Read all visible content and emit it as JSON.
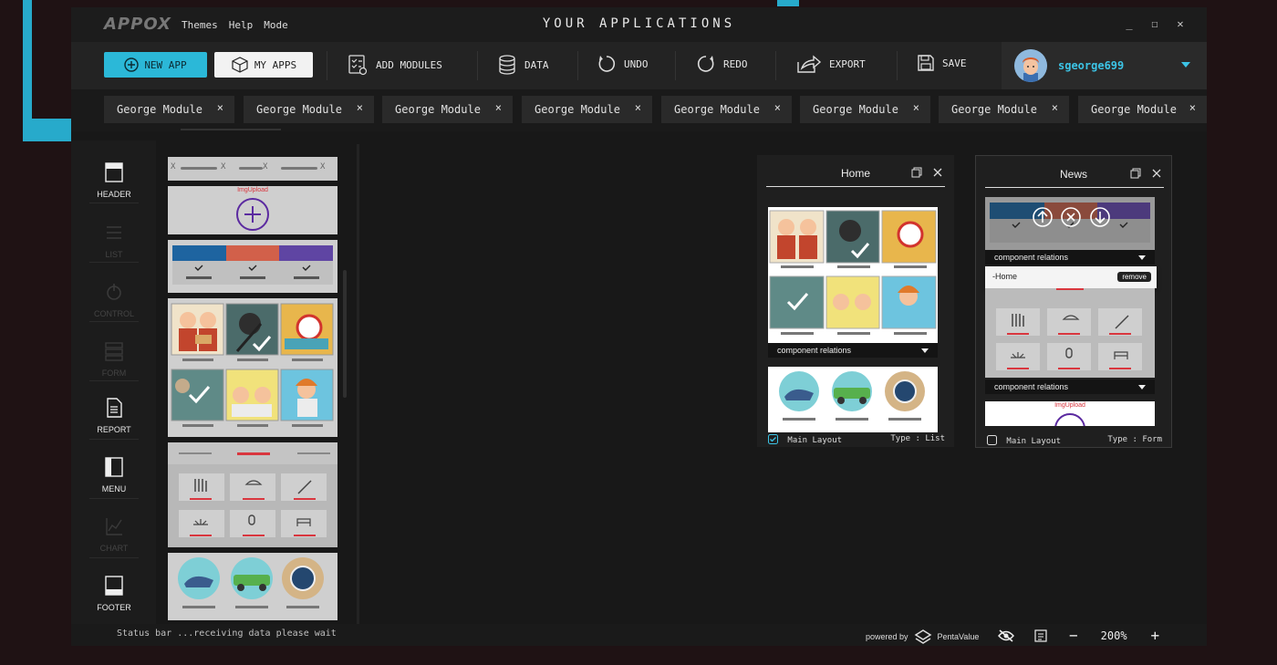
{
  "app": {
    "logo": "APPOX",
    "title": "YOUR APPLICATIONS",
    "menu": [
      "Themes",
      "Help",
      "Mode"
    ],
    "window_controls": {
      "minimize": "_",
      "maximize": "☐",
      "close": "✕"
    }
  },
  "toolbar": {
    "new_app": "NEW APP",
    "my_apps": "MY APPS",
    "add_modules": "ADD MODULES",
    "data": "DATA",
    "undo": "UNDO",
    "redo": "REDO",
    "export": "EXPORT",
    "save": "SAVE",
    "user": "sgeorge699"
  },
  "tabs": [
    "George Module",
    "George Module",
    "George Module",
    "George Module",
    "George Module",
    "George Module",
    "George Module",
    "George Module"
  ],
  "tab_close": "×",
  "sidebar": [
    {
      "label": "HEADER",
      "enabled": true,
      "icon": "header-icon"
    },
    {
      "label": "LIST",
      "enabled": false,
      "icon": "list-icon"
    },
    {
      "label": "CONTROL",
      "enabled": false,
      "icon": "control-icon"
    },
    {
      "label": "FORM",
      "enabled": false,
      "icon": "form-icon"
    },
    {
      "label": "REPORT",
      "enabled": true,
      "icon": "report-icon"
    },
    {
      "label": "MENU",
      "enabled": true,
      "icon": "menu-icon"
    },
    {
      "label": "CHART",
      "enabled": false,
      "icon": "chart-icon"
    },
    {
      "label": "FOOTER",
      "enabled": true,
      "icon": "footer-icon"
    }
  ],
  "preview": {
    "tab_x": "X",
    "img_upload": "ImgUpload"
  },
  "cards": {
    "home": {
      "title": "Home",
      "relations": "component relations",
      "footer": "Main Layout",
      "type": "Type : List"
    },
    "news": {
      "title": "News",
      "relations": "component relations",
      "relation_item": "-Home",
      "remove": "remove",
      "relations2": "component relations",
      "img_upload": "ImgUpload",
      "footer": "Main Layout",
      "type": "Type : Form"
    }
  },
  "status": {
    "text": "Status bar ...receiving data please wait",
    "powered_by": "powered by",
    "brand": "PentaValue",
    "zoom": "200%",
    "zoom_out": "−",
    "zoom_in": "+"
  },
  "colors": {
    "accent": "#2bb8d8",
    "strip_blue": "#1e64a0",
    "strip_orange": "#d2604a",
    "strip_purple": "#5f45a3",
    "underline_red": "#d9363e"
  }
}
